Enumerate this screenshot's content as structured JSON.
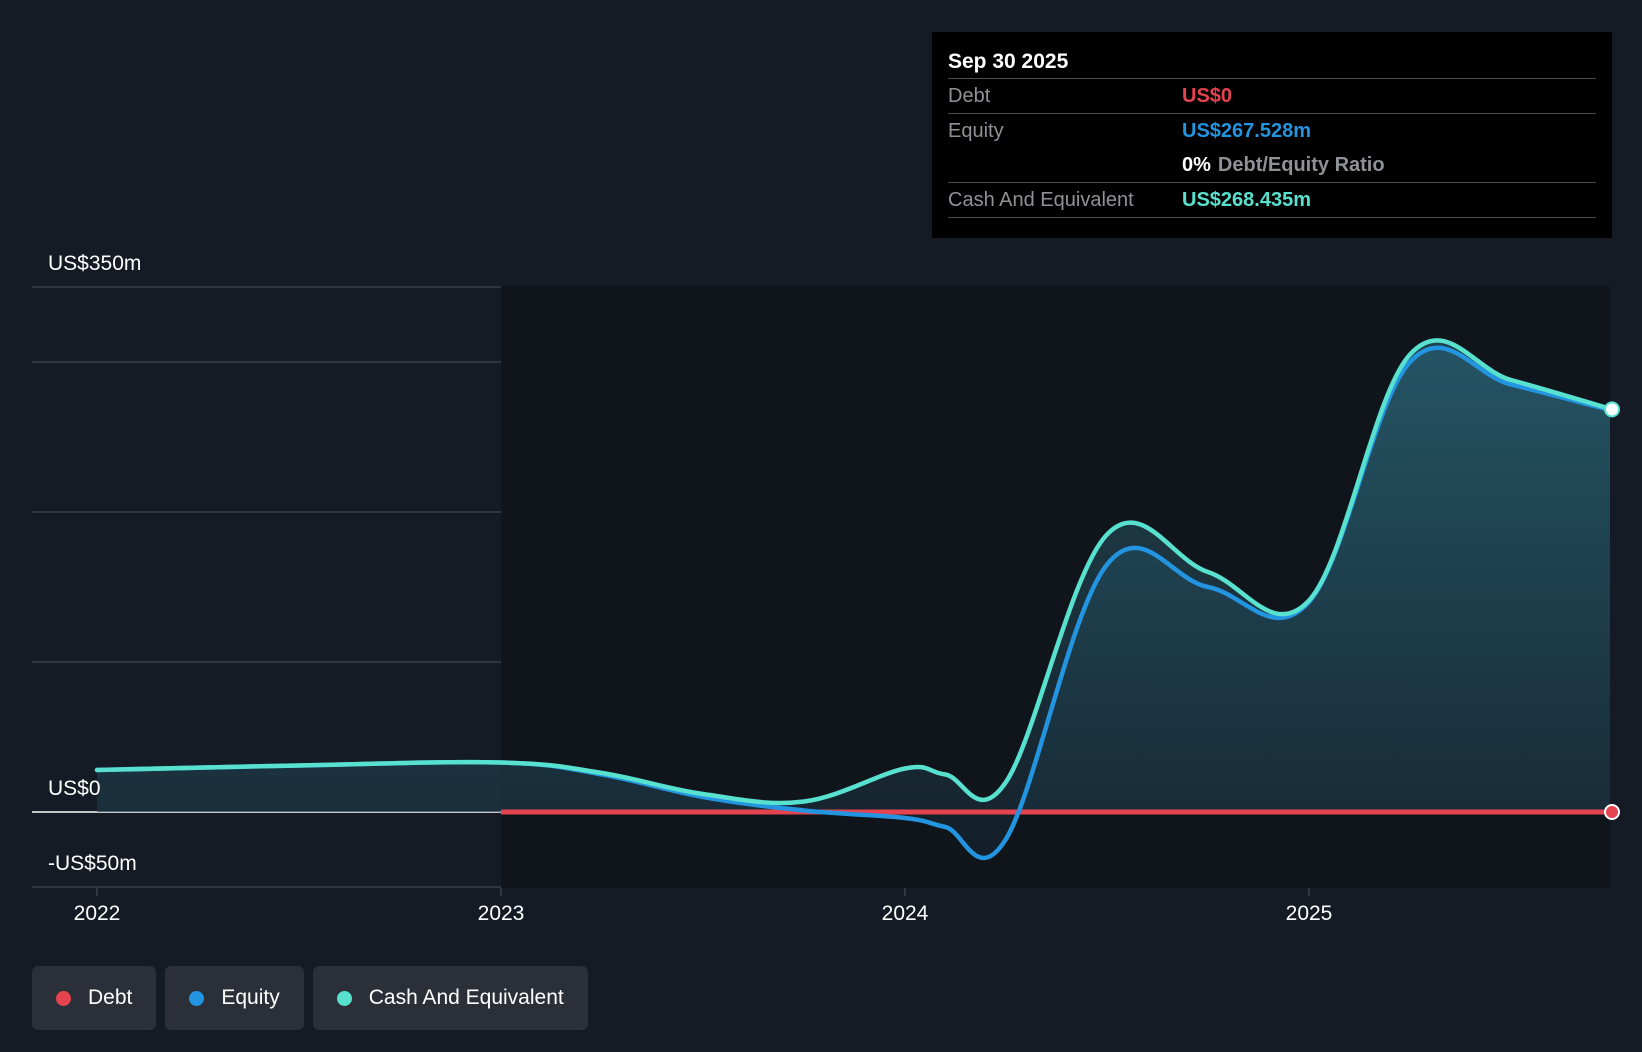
{
  "chart_data": {
    "type": "area",
    "x_ticks": [
      "2022",
      "2023",
      "2024",
      "2025"
    ],
    "y_labels": [
      "US$350m",
      "US$0",
      "-US$50m"
    ],
    "ylim": [
      -50,
      350
    ],
    "grid": true,
    "legend_position": "bottom-left",
    "series": [
      {
        "name": "Debt",
        "color": "#e5434f",
        "points": [
          [
            2023.0,
            0
          ],
          [
            2025.75,
            0
          ]
        ]
      },
      {
        "name": "Equity",
        "color": "#2394df",
        "points": [
          [
            2022.0,
            28
          ],
          [
            2022.5,
            31
          ],
          [
            2023.0,
            33
          ],
          [
            2023.25,
            25
          ],
          [
            2023.5,
            10
          ],
          [
            2023.75,
            1
          ],
          [
            2024.0,
            -4
          ],
          [
            2024.1,
            -10
          ],
          [
            2024.25,
            -18
          ],
          [
            2024.5,
            165
          ],
          [
            2024.75,
            150
          ],
          [
            2025.0,
            140
          ],
          [
            2025.25,
            300
          ],
          [
            2025.5,
            285
          ],
          [
            2025.75,
            267.528
          ]
        ]
      },
      {
        "name": "Cash And Equivalent",
        "color": "#58e1cf",
        "points": [
          [
            2022.0,
            28
          ],
          [
            2022.5,
            31
          ],
          [
            2023.0,
            33
          ],
          [
            2023.25,
            26
          ],
          [
            2023.5,
            12
          ],
          [
            2023.75,
            7
          ],
          [
            2024.0,
            29
          ],
          [
            2024.1,
            25
          ],
          [
            2024.25,
            20
          ],
          [
            2024.5,
            185
          ],
          [
            2024.75,
            160
          ],
          [
            2025.0,
            141
          ],
          [
            2025.25,
            305
          ],
          [
            2025.5,
            288
          ],
          [
            2025.75,
            268.435
          ]
        ]
      }
    ]
  },
  "tooltip": {
    "date": "Sep 30 2025",
    "debt_label": "Debt",
    "debt_value": "US$0",
    "equity_label": "Equity",
    "equity_value": "US$267.528m",
    "ratio_value": "0%",
    "ratio_label": "Debt/Equity Ratio",
    "cash_label": "Cash And Equivalent",
    "cash_value": "US$268.435m"
  },
  "legend": [
    {
      "label": "Debt",
      "color": "#e5434f"
    },
    {
      "label": "Equity",
      "color": "#2394df"
    },
    {
      "label": "Cash And Equivalent",
      "color": "#58e1cf"
    }
  ],
  "colors": {
    "background": "#151b24",
    "plot_future": "#10151c",
    "grid": "#3a4049",
    "debt": "#e5434f",
    "equity": "#2394df",
    "cash": "#58e1cf"
  }
}
